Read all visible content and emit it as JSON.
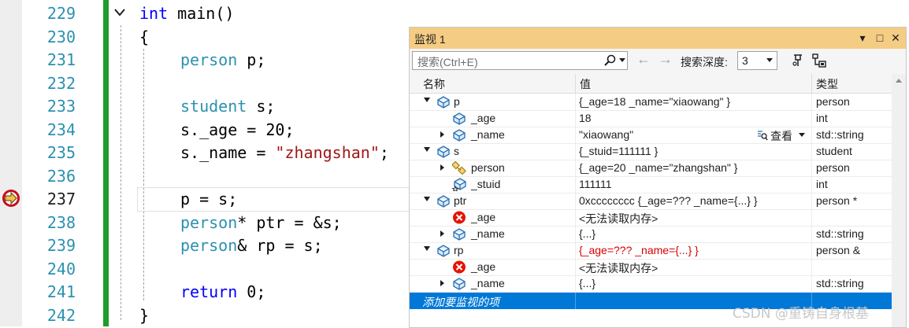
{
  "editor": {
    "line_numbers": [
      "229",
      "230",
      "231",
      "232",
      "233",
      "234",
      "235",
      "236",
      "237",
      "238",
      "239",
      "240",
      "241",
      "242"
    ],
    "current_line": "237",
    "code": {
      "l229": {
        "kw": "int",
        "rest": " main()"
      },
      "l230": "{",
      "l231": {
        "ty": "person",
        "rest": " p;"
      },
      "l233": {
        "ty": "student",
        "rest": " s;"
      },
      "l234": "s._age = 20;",
      "l235": {
        "pre": "s._name = ",
        "str": "\"zhangshan\"",
        "post": ";"
      },
      "l237": "p = s;",
      "l238": {
        "ty": "person",
        "rest": "* ptr = &s;"
      },
      "l239": {
        "ty": "person",
        "rest": "& rp = s;"
      },
      "l241": {
        "kw": "return",
        "rest": " 0;"
      },
      "l242": "}"
    }
  },
  "watch": {
    "title": "监视 1",
    "controls": {
      "dropdown": "▾",
      "maximize": "□",
      "close": "✕"
    },
    "search_placeholder": "搜索(Ctrl+E)",
    "nav_back": "←",
    "nav_forward": "→",
    "depth_label": "搜索深度:",
    "depth_value": "3",
    "headers": {
      "name": "名称",
      "value": "值",
      "type": "类型"
    },
    "view_label": "查看",
    "add_placeholder": "添加要监视的项",
    "rows": [
      {
        "name": "p",
        "value": "{_age=18 _name=\"xiaowang\" }",
        "type": "person"
      },
      {
        "name": "_age",
        "value": "18",
        "type": "int"
      },
      {
        "name": "_name",
        "value": "\"xiaowang\"",
        "type": "std::string"
      },
      {
        "name": "s",
        "value": "{_stuid=111111 }",
        "type": "student"
      },
      {
        "name": "person",
        "value": "{_age=20 _name=\"zhangshan\" }",
        "type": "person"
      },
      {
        "name": "_stuid",
        "value": "111111",
        "type": "int"
      },
      {
        "name": "ptr",
        "value": "0xcccccccc {_age=??? _name={...} }",
        "type": "person *"
      },
      {
        "name": "_age",
        "value": "<无法读取内存>",
        "type": ""
      },
      {
        "name": "_name",
        "value": "{...}",
        "type": "std::string"
      },
      {
        "name": "rp",
        "value": "{_age=??? _name={...} }",
        "type": "person &"
      },
      {
        "name": "_age",
        "value": "<无法读取内存>",
        "type": ""
      },
      {
        "name": "_name",
        "value": "{...}",
        "type": "std::string"
      }
    ]
  },
  "watermark": "CSDN @重铸自身根基",
  "colors": {
    "title_bar": "#f5cc84",
    "selection": "#0078d7",
    "change_bar": "#1f9c2b",
    "error": "#d80000"
  }
}
